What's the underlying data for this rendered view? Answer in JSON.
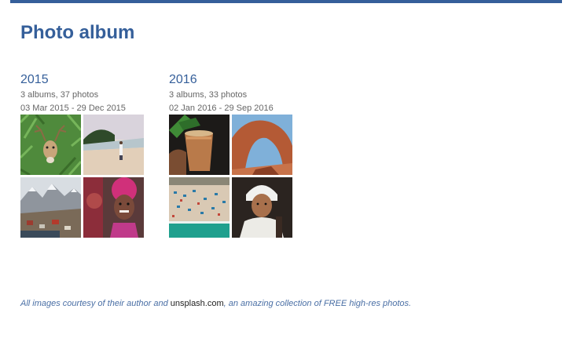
{
  "page": {
    "title": "Photo album",
    "accent": "#355f9a"
  },
  "years": [
    {
      "year": "2015",
      "summary": "3 albums, 37 photos",
      "date_range": "03 Mar 2015 - 29 Dec 2015",
      "photos": [
        "deer-in-grass",
        "beach-walker",
        "snowy-mountain-village",
        "smiling-girl-with-color"
      ]
    },
    {
      "year": "2016",
      "summary": "3 albums, 33 photos",
      "date_range": "02 Jan 2016 - 29 Sep 2016",
      "photos": [
        "iced-drink-with-mint",
        "desert-rock-arch",
        "aerial-beach",
        "woman-with-headscarf"
      ]
    }
  ],
  "footer": {
    "text_before": "All images courtesy of their author and ",
    "link": "unsplash.com",
    "text_after": ", an amazing collection of FREE high-res photos."
  }
}
